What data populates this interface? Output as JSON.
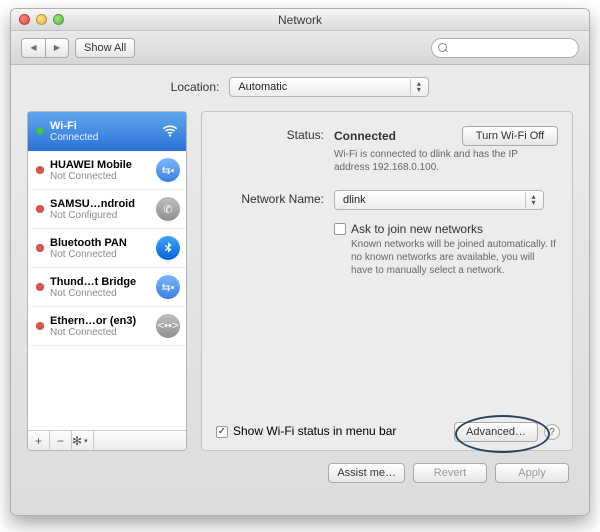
{
  "window": {
    "title": "Network"
  },
  "toolbar": {
    "back_icon": "◀",
    "fwd_icon": "▶",
    "show_all_label": "Show All",
    "search_placeholder": ""
  },
  "location": {
    "label": "Location:",
    "value": "Automatic"
  },
  "sidebar": {
    "items": [
      {
        "name": "Wi-Fi",
        "sub": "Connected",
        "status": "green",
        "icon": "wifi",
        "selected": true
      },
      {
        "name": "HUAWEI Mobile",
        "sub": "Not Connected",
        "status": "red",
        "icon": "sync",
        "selected": false
      },
      {
        "name": "SAMSU…ndroid",
        "sub": "Not Configured",
        "status": "red",
        "icon": "phone",
        "selected": false
      },
      {
        "name": "Bluetooth PAN",
        "sub": "Not Connected",
        "status": "red",
        "icon": "bt",
        "selected": false
      },
      {
        "name": "Thund…t Bridge",
        "sub": "Not Connected",
        "status": "red",
        "icon": "sync",
        "selected": false
      },
      {
        "name": "Ethern…or (en3)",
        "sub": "Not Connected",
        "status": "red",
        "icon": "eth",
        "selected": false
      }
    ],
    "footer": {
      "plus": "+",
      "minus": "−",
      "gear": "✻",
      "gear_arrow": "▾"
    }
  },
  "detail": {
    "status_label": "Status:",
    "status_value": "Connected",
    "wifi_off_button": "Turn Wi-Fi Off",
    "status_desc": "Wi-Fi is connected to dlink and has the IP address 192.168.0.100.",
    "network_name_label": "Network Name:",
    "network_name_value": "dlink",
    "ask_join_label": "Ask to join new networks",
    "ask_join_checked": false,
    "ask_join_desc": "Known networks will be joined automatically. If no known networks are available, you will have to manually select a network.",
    "show_menubar_label": "Show Wi-Fi status in menu bar",
    "show_menubar_checked": true,
    "advanced_button": "Advanced…",
    "help_glyph": "?"
  },
  "footer": {
    "assist_label": "Assist me…",
    "revert_label": "Revert",
    "apply_label": "Apply"
  }
}
